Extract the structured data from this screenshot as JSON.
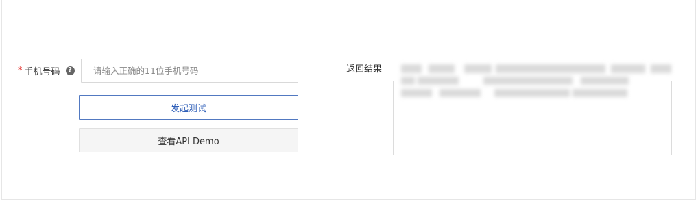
{
  "form": {
    "required_mark": "*",
    "phone_label": "手机号码",
    "help_icon_glyph": "?",
    "phone_placeholder": "请输入正确的11位手机号码",
    "submit_label": "发起测试",
    "demo_label": "查看API Demo"
  },
  "result": {
    "label": "返回结果",
    "content_state": "blurred"
  },
  "icons": {
    "help": "question-circle-icon"
  },
  "colors": {
    "primary_border": "#5279c1",
    "primary_text": "#2f5fb8",
    "required": "#e53935"
  }
}
